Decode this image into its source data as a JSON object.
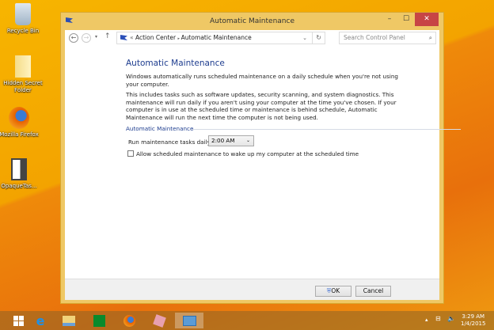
{
  "desktop": {
    "icons": [
      {
        "label": "Recycle Bin",
        "icon": "recycle-bin-icon"
      },
      {
        "label": "Hidden Secret Folder",
        "icon": "folder-icon"
      },
      {
        "label": "Mozilla Firefox",
        "icon": "firefox-icon"
      },
      {
        "label": "OpaqueTas...",
        "icon": "app-icon"
      }
    ]
  },
  "window": {
    "title": "Automatic Maintenance",
    "close": "✕",
    "minimize": "–",
    "maximize": "☐"
  },
  "nav": {
    "breadcrumb_sep": "«",
    "crumb1": "Action Center",
    "crumb2": "Automatic Maintenance",
    "search_placeholder": "Search Control Panel"
  },
  "main": {
    "heading": "Automatic Maintenance",
    "para1": "Windows automatically runs scheduled maintenance on a daily schedule when you're not using your computer.",
    "para2": "This includes tasks such as software updates, security scanning, and system diagnostics. This maintenance will run daily if you aren't using your computer at the time you've chosen. If your computer is in use at the scheduled time or maintenance is behind schedule, Automatic Maintenance will run the next time the computer is not being used.",
    "group_label": "Automatic Maintenance",
    "run_label": "Run maintenance tasks daily at",
    "time_value": "2:00 AM",
    "wake_label": "Allow scheduled maintenance to wake up my computer at the scheduled time",
    "wake_checked": false
  },
  "footer": {
    "ok": "OK",
    "cancel": "Cancel"
  },
  "taskbar": {
    "time": "3:29 AM",
    "date": "1/4/2015"
  }
}
